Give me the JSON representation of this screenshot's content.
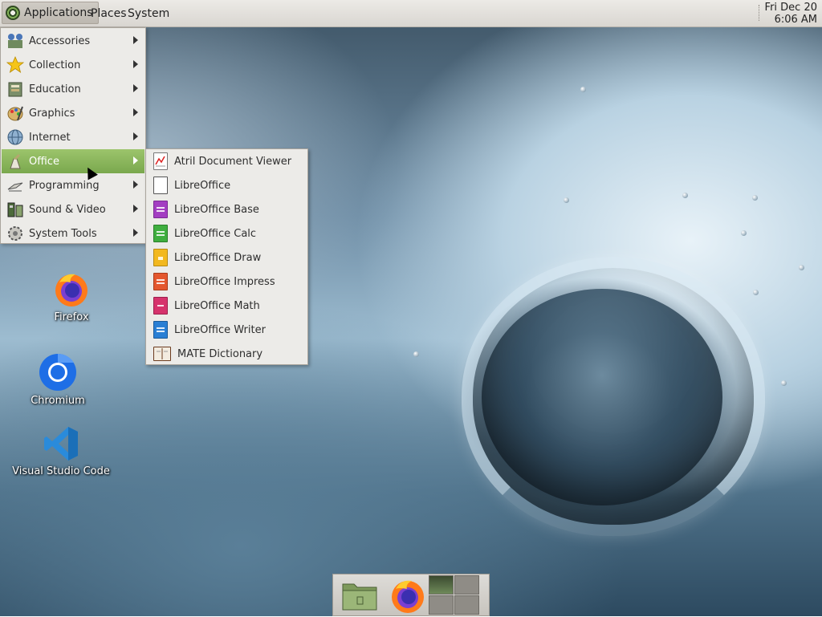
{
  "top_panel": {
    "applications_label": "Applications",
    "places_label": "Places",
    "system_label": "System",
    "clock_date": "Fri Dec 20",
    "clock_time": "6:06 AM"
  },
  "apps_menu": {
    "items": [
      {
        "label": "Accessories",
        "icon": "accessories-icon"
      },
      {
        "label": "Collection",
        "icon": "star-icon"
      },
      {
        "label": "Education",
        "icon": "education-icon"
      },
      {
        "label": "Graphics",
        "icon": "graphics-icon"
      },
      {
        "label": "Internet",
        "icon": "globe-icon"
      },
      {
        "label": "Office",
        "icon": "office-icon"
      },
      {
        "label": "Programming",
        "icon": "programming-icon"
      },
      {
        "label": "Sound & Video",
        "icon": "sound-video-icon"
      },
      {
        "label": "System Tools",
        "icon": "gear-icon"
      }
    ],
    "active_item": "Office"
  },
  "office_menu": {
    "items": [
      {
        "label": "Atril Document Viewer",
        "icon": "document-viewer-icon",
        "color": "#ffffff"
      },
      {
        "label": "LibreOffice",
        "icon": "libreoffice-icon",
        "color": "#ffffff"
      },
      {
        "label": "LibreOffice Base",
        "icon": "libreoffice-base-icon",
        "color": "#a33ec2"
      },
      {
        "label": "LibreOffice Calc",
        "icon": "libreoffice-calc-icon",
        "color": "#3fae3f"
      },
      {
        "label": "LibreOffice Draw",
        "icon": "libreoffice-draw-icon",
        "color": "#f2b81f"
      },
      {
        "label": "LibreOffice Impress",
        "icon": "libreoffice-impress-icon",
        "color": "#e4572e"
      },
      {
        "label": "LibreOffice Math",
        "icon": "libreoffice-math-icon",
        "color": "#d6336c"
      },
      {
        "label": "LibreOffice Writer",
        "icon": "libreoffice-writer-icon",
        "color": "#2a7fd4"
      },
      {
        "label": "MATE Dictionary",
        "icon": "dictionary-icon",
        "color": "#ffffff"
      }
    ]
  },
  "desktop_icons": [
    {
      "label": "Firefox",
      "icon": "firefox-icon"
    },
    {
      "label": "Chromium",
      "icon": "chromium-icon"
    },
    {
      "label": "Visual Studio Code",
      "icon": "vscode-icon"
    }
  ],
  "dock": {
    "items": [
      "file-manager-icon",
      "firefox-icon",
      "workspace-switcher"
    ]
  },
  "colors": {
    "menu_highlight": "#86b15a",
    "panel_bg": "#e3e0dc"
  }
}
